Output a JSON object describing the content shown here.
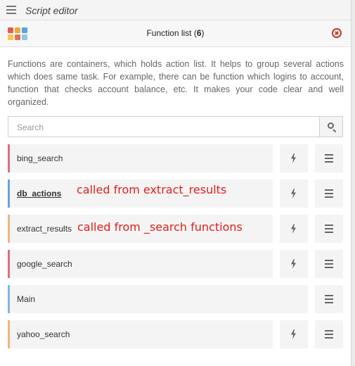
{
  "editor": {
    "title": "Script editor"
  },
  "function_list": {
    "title": "Function list",
    "count": "6",
    "description": "Functions are containers, which holds action list. It helps to group several actions which does same task. For example, there can be function which logins to account, function that checks account balance, etc. It makes your code clear and well organized."
  },
  "search": {
    "placeholder": "Search",
    "value": ""
  },
  "functions": [
    {
      "name": "bing_search",
      "accent": "#d9717c",
      "has_run": true,
      "active": false
    },
    {
      "name": "db_actions",
      "accent": "#6aa2d8",
      "has_run": true,
      "active": true
    },
    {
      "name": "extract_results",
      "accent": "#e9b87c",
      "has_run": true,
      "active": false
    },
    {
      "name": "google_search",
      "accent": "#d9717c",
      "has_run": true,
      "active": false
    },
    {
      "name": "Main",
      "accent": "#7fb6e0",
      "has_run": false,
      "active": false
    },
    {
      "name": "yahoo_search",
      "accent": "#e9b87c",
      "has_run": true,
      "active": false
    }
  ],
  "annotations": {
    "db_actions": "called from extract_results",
    "extract_results": "called from _search functions"
  },
  "icons": {
    "menu": "hamburger-icon",
    "app": "grid-icon",
    "close": "close-circle-icon",
    "search": "search-icon",
    "run": "lightning-icon",
    "row_menu": "hamburger-icon"
  },
  "colors": {
    "close": "#c0392b",
    "annotation": "#e0201b",
    "grid": [
      "#e15a5a",
      "#f0a940",
      "#5aa3e0",
      "#f3c94e",
      "#e0734f",
      "#8fc7e8"
    ]
  }
}
